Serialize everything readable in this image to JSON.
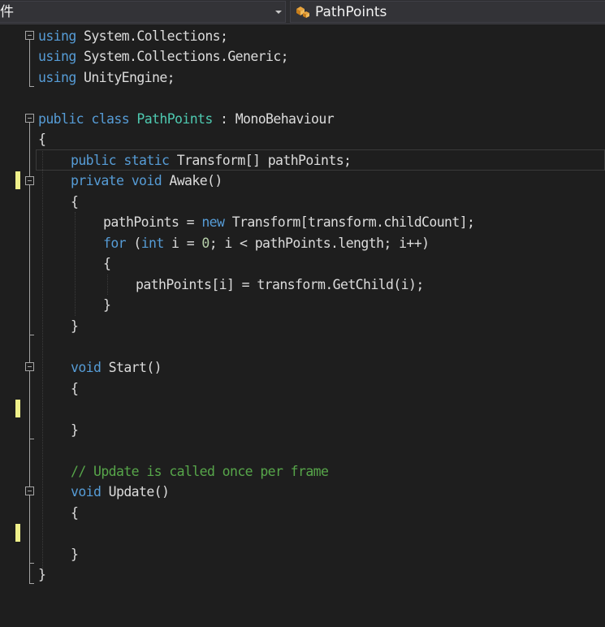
{
  "navbar": {
    "left_combo_text": "件",
    "right_combo_text": "PathPoints",
    "right_combo_icon": "class-icon"
  },
  "code": {
    "l1": {
      "kw": "using",
      "rest": " System.Collections;"
    },
    "l2": {
      "kw": "using",
      "rest": " System.Collections.Generic;"
    },
    "l3": {
      "kw": "using",
      "rest": " UnityEngine;"
    },
    "l5": {
      "kw1": "public",
      "kw2": "class",
      "cls": "PathPoints",
      "rest": " : MonoBehaviour"
    },
    "l6": {
      "text": "{"
    },
    "l7": {
      "kw1": "public",
      "kw2": "static",
      "rest": " Transform[] pathPoints;"
    },
    "l8": {
      "kw1": "private",
      "kw2": "void",
      "rest": " Awake()"
    },
    "l9": {
      "text": "{"
    },
    "l10": {
      "pre": "pathPoints = ",
      "kw": "new",
      "rest": " Transform[transform.childCount];"
    },
    "l11": {
      "kw1": "for",
      "mid1": " (",
      "kw2": "int",
      "mid2": " i = ",
      "num": "0",
      "rest": "; i < pathPoints.length; i++)"
    },
    "l12": {
      "text": "{"
    },
    "l13": {
      "text": "pathPoints[i] = transform.GetChild(i);"
    },
    "l14": {
      "text": "}"
    },
    "l15": {
      "text": "}"
    },
    "l17": {
      "kw": "void",
      "rest": " Start()"
    },
    "l18": {
      "text": "{"
    },
    "l20": {
      "text": "}"
    },
    "l22": {
      "comment": "// Update is called once per frame"
    },
    "l23": {
      "kw": "void",
      "rest": " Update()"
    },
    "l24": {
      "text": "{"
    },
    "l26": {
      "text": "}"
    },
    "l27": {
      "text": "}"
    }
  },
  "colors": {
    "keyword": "#569cd6",
    "type": "#4ec9b0",
    "number": "#b5cea8",
    "comment": "#57a64a",
    "text": "#dcdcdc",
    "change_marker": "#eff08a"
  }
}
